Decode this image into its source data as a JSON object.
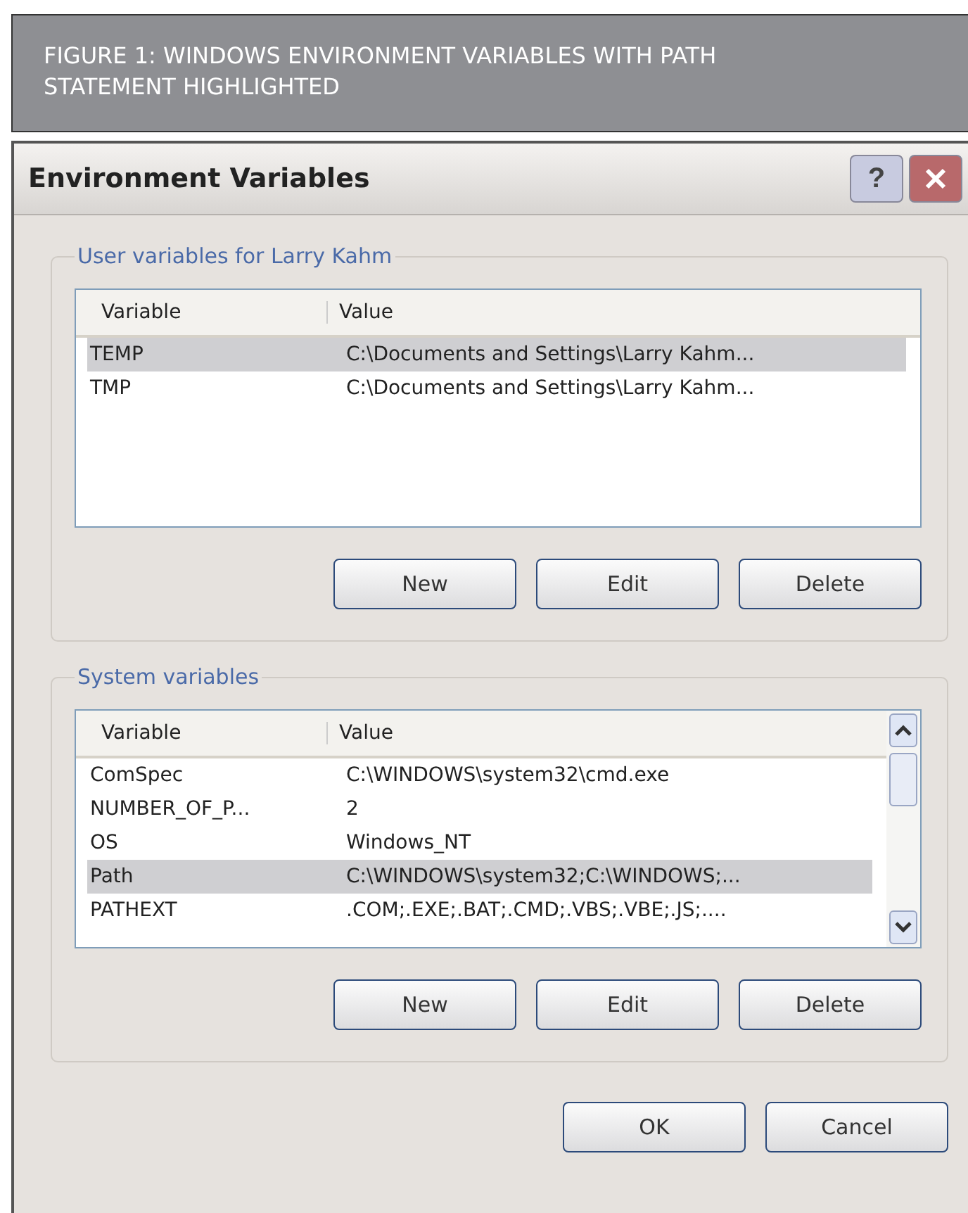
{
  "caption": "FIGURE 1: WINDOWS ENVIRONMENT VARIABLES WITH PATH STATEMENT HIGHLIGHTED",
  "window": {
    "title": "Environment Variables",
    "help": "?"
  },
  "groups": [
    {
      "title": "User variables for Larry Kahm",
      "columns": [
        "Variable",
        "Value"
      ],
      "scrollbar": false,
      "rows": [
        {
          "variable": "TEMP",
          "value": "C:\\Documents and Settings\\Larry Kahm...",
          "selected": true
        },
        {
          "variable": "TMP",
          "value": "C:\\Documents and Settings\\Larry Kahm...",
          "selected": false
        }
      ],
      "buttons": [
        "New",
        "Edit",
        "Delete"
      ]
    },
    {
      "title": "System variables",
      "columns": [
        "Variable",
        "Value"
      ],
      "scrollbar": true,
      "rows": [
        {
          "variable": "ComSpec",
          "value": "C:\\WINDOWS\\system32\\cmd.exe",
          "selected": false
        },
        {
          "variable": "NUMBER_OF_P...",
          "value": "2",
          "selected": false
        },
        {
          "variable": "OS",
          "value": "Windows_NT",
          "selected": false
        },
        {
          "variable": "Path",
          "value": "C:\\WINDOWS\\system32;C:\\WINDOWS;...",
          "selected": true
        },
        {
          "variable": "PATHEXT",
          "value": ".COM;.EXE;.BAT;.CMD;.VBS;.VBE;.JS;....",
          "selected": false
        }
      ],
      "buttons": [
        "New",
        "Edit",
        "Delete"
      ]
    }
  ],
  "footer_buttons": [
    "OK",
    "Cancel"
  ]
}
